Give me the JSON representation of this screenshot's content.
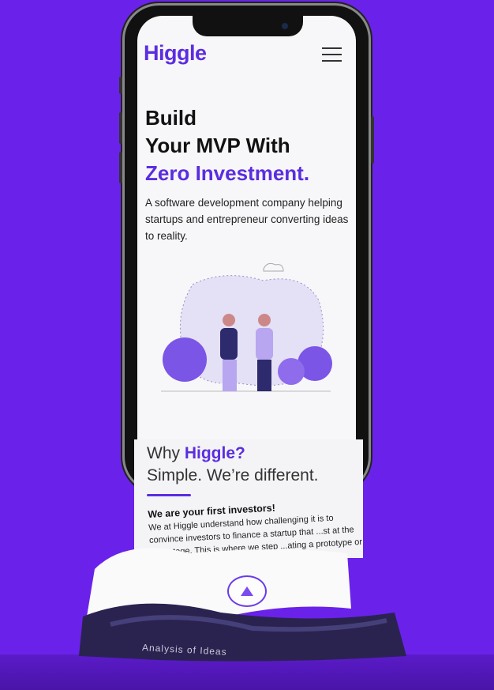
{
  "header": {
    "logo": "Higgle",
    "menu_icon": "hamburger-icon"
  },
  "hero": {
    "line1": "Build",
    "line2": "Your MVP With",
    "line3": "Zero Investment.",
    "subtitle": "A software development company helping startups and entrepreneur converting ideas to reality."
  },
  "why": {
    "prefix": "Why ",
    "brand": "Higgle?",
    "tagline": "Simple. We’re different."
  },
  "section": {
    "title": "We are your first investors!",
    "body": "We at Higgle understand how challenging it is to convince investors to finance a startup that ...st at the idea stage. This is where we step ...ating a prototype or developing a ...Product, we give shape to"
  },
  "next_section_label": "Analysis of Ideas",
  "colors": {
    "background": "#6a22ea",
    "accent": "#5b2de0"
  }
}
